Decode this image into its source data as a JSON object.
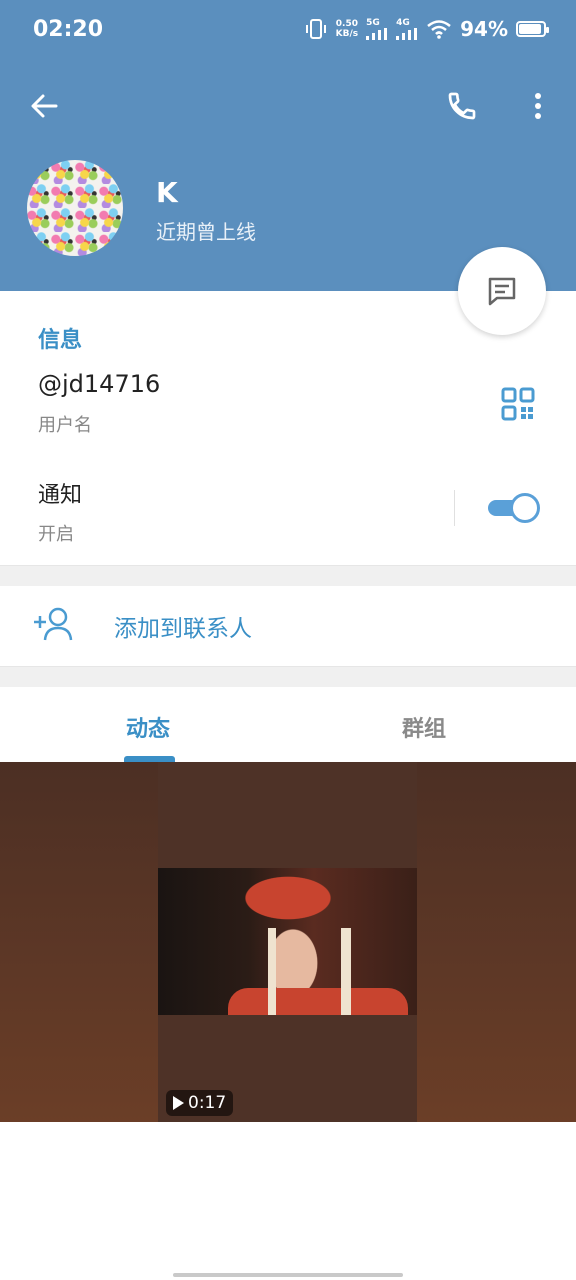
{
  "status_bar": {
    "time": "02:20",
    "speed_value": "0.50",
    "speed_unit": "KB/s",
    "net1": "5G",
    "net2": "4G",
    "battery_pct": "94%",
    "battery_level": 0.94
  },
  "profile": {
    "name": "K",
    "last_seen": "近期曾上线"
  },
  "info": {
    "section_title": "信息",
    "username": "@jd14716",
    "username_label": "用户名",
    "notifications_label": "通知",
    "notifications_state": "开启",
    "notifications_on": true
  },
  "actions": {
    "add_contact": "添加到联系人"
  },
  "tabs": [
    {
      "label": "动态",
      "active": true
    },
    {
      "label": "群组",
      "active": false
    }
  ],
  "media": {
    "duration": "0:17"
  },
  "colors": {
    "header": "#5b8fbe",
    "accent": "#3a8fc6"
  }
}
